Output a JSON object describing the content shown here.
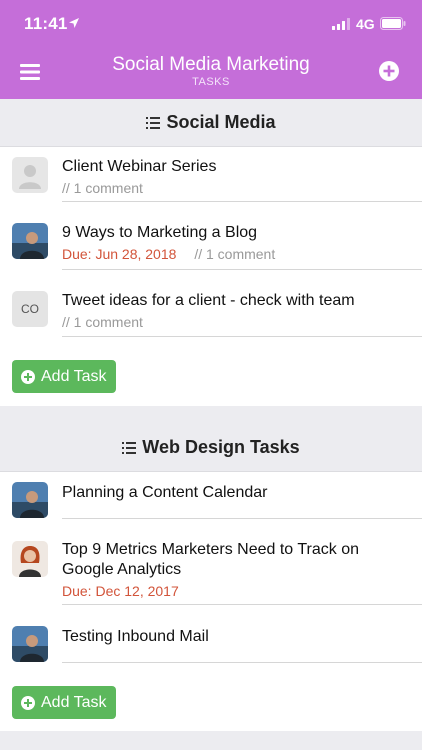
{
  "status_bar": {
    "time": "11:41",
    "network": "4G"
  },
  "nav": {
    "title": "Social Media Marketing",
    "subtitle": "TASKS"
  },
  "sections": [
    {
      "title": "Social Media",
      "tasks": [
        {
          "title": "Client Webinar Series",
          "due": "",
          "comments": "// 1 comment",
          "avatar": "placeholder"
        },
        {
          "title": "9 Ways to Marketing a Blog",
          "due": "Due: Jun 28, 2018",
          "comments": "// 1 comment",
          "avatar": "photo-man"
        },
        {
          "title": "Tweet ideas for a client - check with team",
          "due": "",
          "comments": "// 1 comment",
          "avatar": "initials",
          "initials": "CO"
        }
      ],
      "add_label": "Add Task"
    },
    {
      "title": "Web Design Tasks",
      "tasks": [
        {
          "title": "Planning a Content Calendar",
          "due": "",
          "comments": "",
          "avatar": "photo-man"
        },
        {
          "title": "Top 9 Metrics Marketers Need to Track on Google Analytics",
          "due": "Due: Dec 12, 2017",
          "comments": "",
          "avatar": "photo-woman"
        },
        {
          "title": "Testing Inbound Mail",
          "due": "",
          "comments": "",
          "avatar": "photo-man"
        }
      ],
      "add_label": "Add Task"
    }
  ],
  "colors": {
    "header": "#c56ed9",
    "due": "#d2543a",
    "add_button": "#5cb85c"
  }
}
